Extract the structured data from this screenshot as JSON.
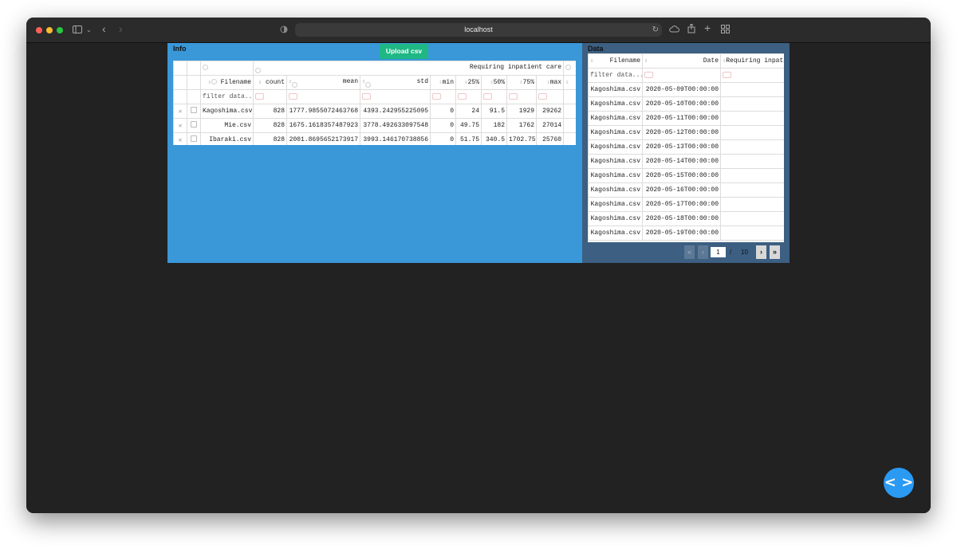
{
  "browser": {
    "url": "localhost"
  },
  "info": {
    "title": "Info",
    "upload_label": "Upload csv",
    "group_header": "Requiring inpatient care",
    "columns": [
      "Filename",
      "count",
      "mean",
      "std",
      "min",
      "25%",
      "50%",
      "75%",
      "max"
    ],
    "filter_placeholder": "filter data...",
    "rows": [
      [
        "Kagoshima.csv",
        "828",
        "1777.9855072463768",
        "4393.242955225095",
        "0",
        "24",
        "91.5",
        "1929",
        "29262"
      ],
      [
        "Mie.csv",
        "828",
        "1675.1618357487923",
        "3778.492633097548",
        "0",
        "49.75",
        "182",
        "1762",
        "27014"
      ],
      [
        "Ibaraki.csv",
        "828",
        "2001.8695652173917",
        "3993.146170738856",
        "0",
        "51.75",
        "340.5",
        "1702.75",
        "25760"
      ]
    ]
  },
  "data": {
    "title": "Data",
    "columns": [
      "Filename",
      "Date",
      "Requiring inpatient care"
    ],
    "filter_placeholder": "filter data...",
    "rows": [
      [
        "Kagoshima.csv",
        "2020-05-09T00:00:00",
        ""
      ],
      [
        "Kagoshima.csv",
        "2020-05-10T00:00:00",
        ""
      ],
      [
        "Kagoshima.csv",
        "2020-05-11T00:00:00",
        ""
      ],
      [
        "Kagoshima.csv",
        "2020-05-12T00:00:00",
        ""
      ],
      [
        "Kagoshima.csv",
        "2020-05-13T00:00:00",
        ""
      ],
      [
        "Kagoshima.csv",
        "2020-05-14T00:00:00",
        ""
      ],
      [
        "Kagoshima.csv",
        "2020-05-15T00:00:00",
        ""
      ],
      [
        "Kagoshima.csv",
        "2020-05-16T00:00:00",
        ""
      ],
      [
        "Kagoshima.csv",
        "2020-05-17T00:00:00",
        ""
      ],
      [
        "Kagoshima.csv",
        "2020-05-18T00:00:00",
        ""
      ],
      [
        "Kagoshima.csv",
        "2020-05-19T00:00:00",
        ""
      ]
    ],
    "pager": {
      "current_page": "1",
      "separator": "/",
      "total_pages": "10",
      "first_label": "«",
      "prev_label": "‹",
      "next_label": "›",
      "last_label": "»"
    }
  },
  "fab": {
    "icon": "code-brackets-icon",
    "label": "< >"
  }
}
